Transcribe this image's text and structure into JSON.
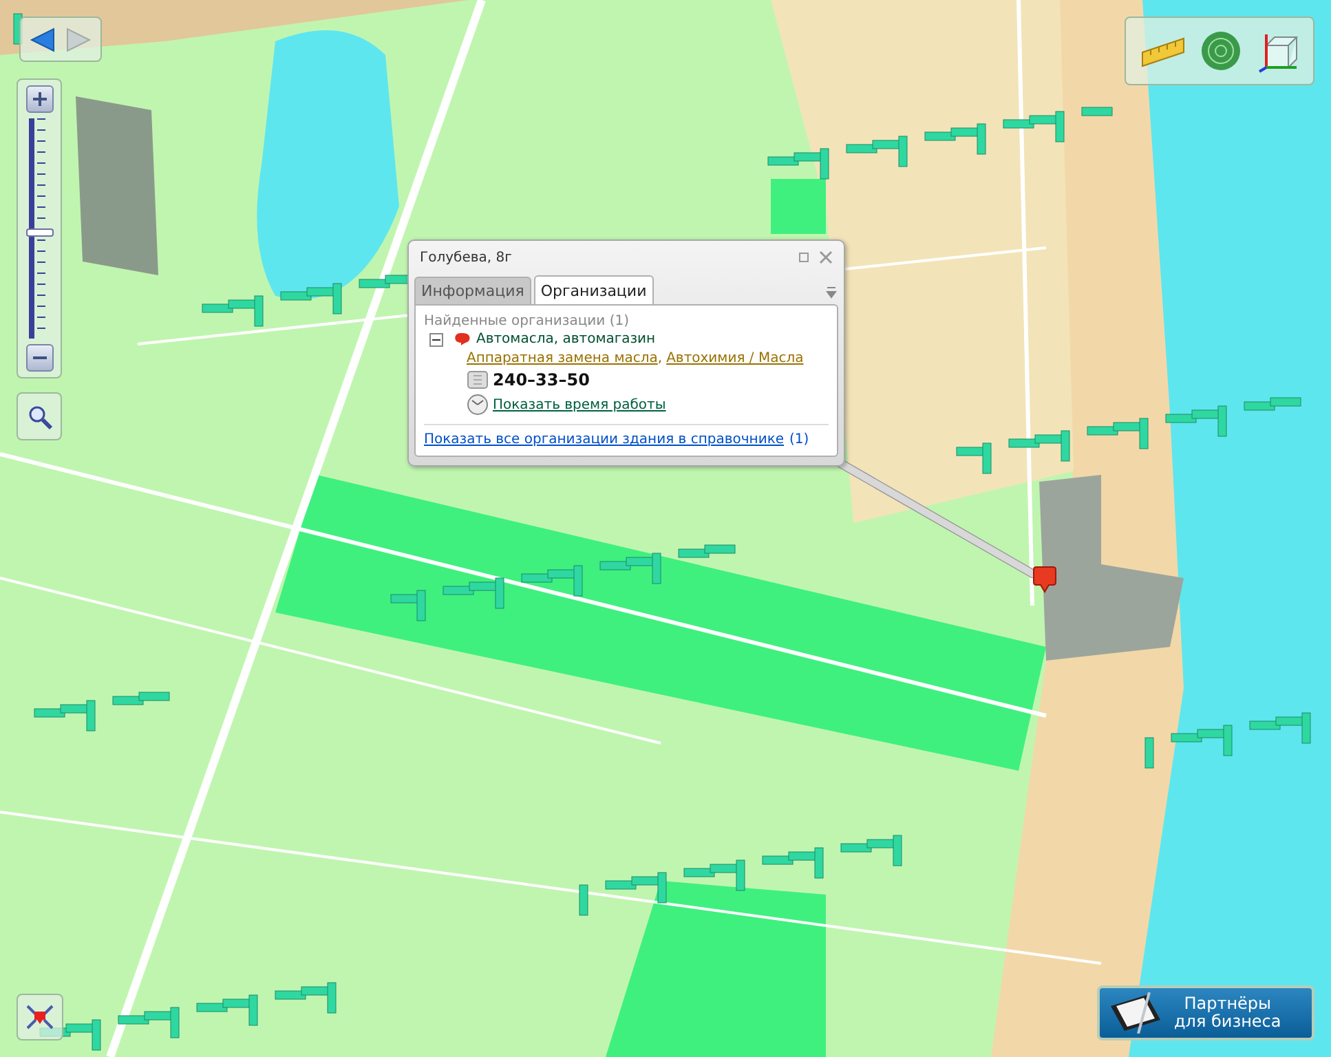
{
  "popup": {
    "title": "Голубева, 8г",
    "tabs": [
      {
        "label": "Информация",
        "selected": false
      },
      {
        "label": "Организации",
        "selected": true
      }
    ],
    "found_heading": "Найденные организации (1)",
    "organizations": [
      {
        "name": "Автомасла, автомагазин",
        "expanded": true,
        "categories": [
          {
            "label": "Аппаратная замена масла",
            "trailing": ","
          },
          {
            "label": "Автохимия / Масла"
          }
        ],
        "phone": "240–33–50",
        "hours_link": "Показать время работы"
      }
    ],
    "all_link": "Показать все организации здания в справочнике",
    "all_count": "(1)"
  },
  "zoom": {
    "level": 0.48
  },
  "partners_button": {
    "line1": "Партнёры",
    "line2": "для бизнеса"
  }
}
